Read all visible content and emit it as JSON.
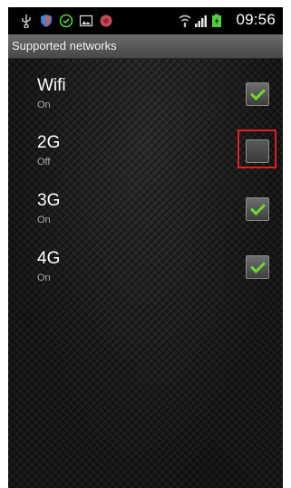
{
  "status_bar": {
    "time": "09:56",
    "left_icons": [
      "usb-icon",
      "shield-icon",
      "check-circle-icon",
      "image-icon",
      "app-icon"
    ],
    "right_icons": [
      "wifi-icon",
      "signal-icon",
      "battery-icon"
    ]
  },
  "title_bar": {
    "title": "Supported networks"
  },
  "networks": [
    {
      "name": "Wifi",
      "state": "On",
      "checked": true
    },
    {
      "name": "2G",
      "state": "Off",
      "checked": false
    },
    {
      "name": "3G",
      "state": "On",
      "checked": true
    },
    {
      "name": "4G",
      "state": "On",
      "checked": true
    }
  ],
  "colors": {
    "check_green": "#6fd82c",
    "highlight_red": "#e02020"
  }
}
